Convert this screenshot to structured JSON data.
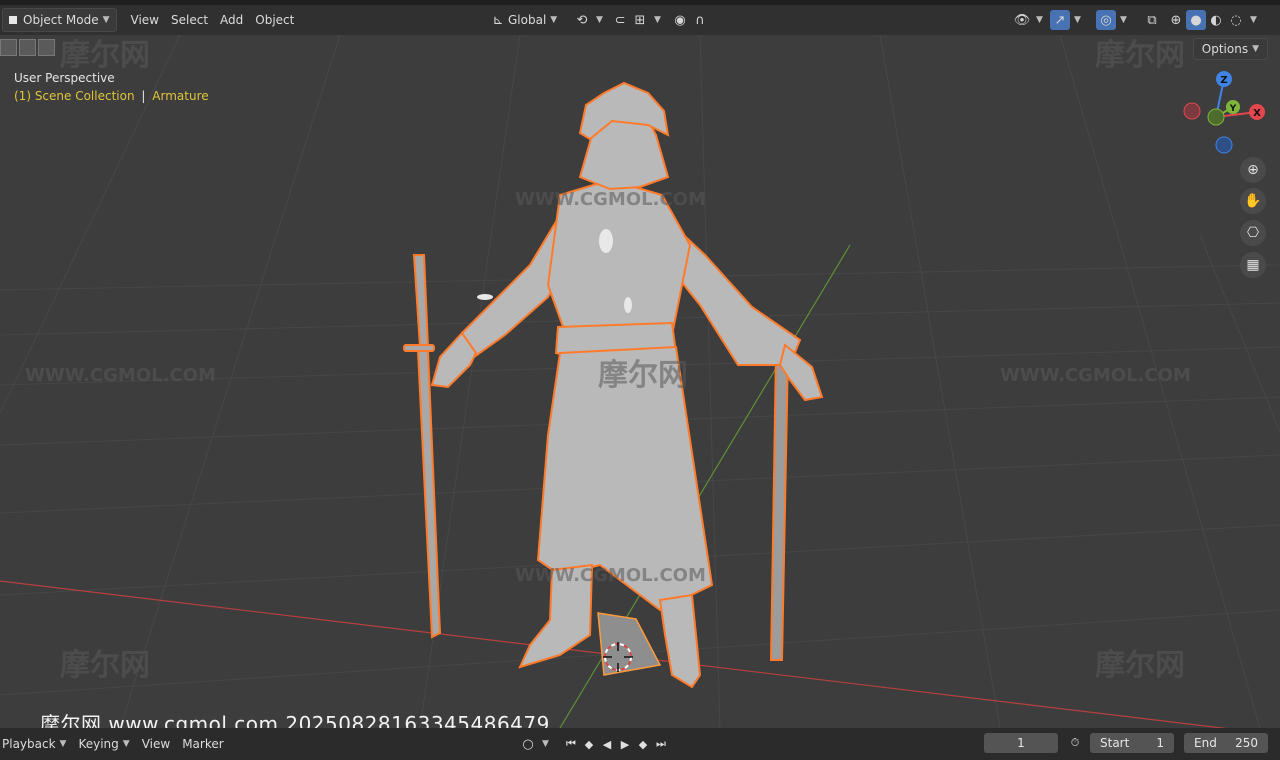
{
  "header": {
    "mode_label": "Object Mode",
    "menu": [
      "View",
      "Select",
      "Add",
      "Object"
    ],
    "transform_orientation": "Global"
  },
  "viewport": {
    "perspective_label": "User Perspective",
    "collection_label": "(1) Scene Collection",
    "active_object": "Armature",
    "options_label": "Options",
    "gizmo_axes": [
      "Z",
      "Y",
      "X"
    ]
  },
  "watermarks": {
    "logo_text": "摩尔网",
    "url_text": "WWW.CGMOL.COM",
    "caption": "摩尔网 www.cgmol.com 20250828163345486479"
  },
  "timeline": {
    "playback_label": "Playback",
    "keying_label": "Keying",
    "view_label": "View",
    "marker_label": "Marker",
    "current_frame": "1",
    "start_label": "Start",
    "start_value": "1",
    "end_label": "End",
    "end_value": "250"
  },
  "colors": {
    "accent_selected": "#ff7a2a",
    "collection_text": "#e0c43a",
    "axis_x": "#e4464e",
    "axis_y": "#7fb63a",
    "axis_z": "#3f83e4"
  }
}
